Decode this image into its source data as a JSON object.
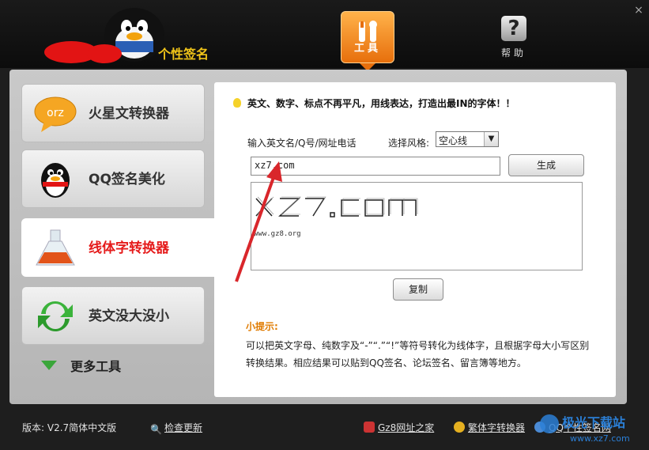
{
  "header": {
    "tools_label": "工具",
    "help_label": "帮助",
    "close_glyph": "×"
  },
  "sidebar": {
    "items": [
      {
        "label": "火星文转换器",
        "icon": "orz-bubble-icon",
        "icon_text": "orz"
      },
      {
        "label": "QQ签名美化",
        "icon": "penguin-icon"
      },
      {
        "label": "线体字转换器",
        "icon": "flask-icon"
      },
      {
        "label": "英文没大没小",
        "icon": "refresh-icon"
      }
    ],
    "more_label": "更多工具"
  },
  "content": {
    "tip": "英文、数字、标点不再平凡，用线表达，打造出最IN的字体！！",
    "input_label": "输入英文名/Q号/网址电话",
    "style_label": "选择风格:",
    "style_value": "空心线",
    "input_value": "xz7.com",
    "generate_label": "生成",
    "output_url": "www.gz8.org",
    "copy_label": "复制",
    "hint_title": "小提示:",
    "hint_body": "可以把英文字母、纯数字及“-”“.”“!”等符号转化为线体字，且根据字母大小写区别转换结果。相应结果可以贴到QQ签名、论坛签名、留言簿等地方。"
  },
  "footer": {
    "version": "版本: V2.7简体中文版",
    "check_update": "检查更新",
    "link_home": "Gz8网址之家",
    "link_trad": "繁体字转换器",
    "link_sign": "QQ个性签名网",
    "watermark_text": "极光下载站",
    "watermark_url": "www.xz7.com"
  },
  "colors": {
    "accent_orange": "#e76f0c",
    "active_red": "#e51b1b",
    "hint_orange": "#e07b00"
  }
}
